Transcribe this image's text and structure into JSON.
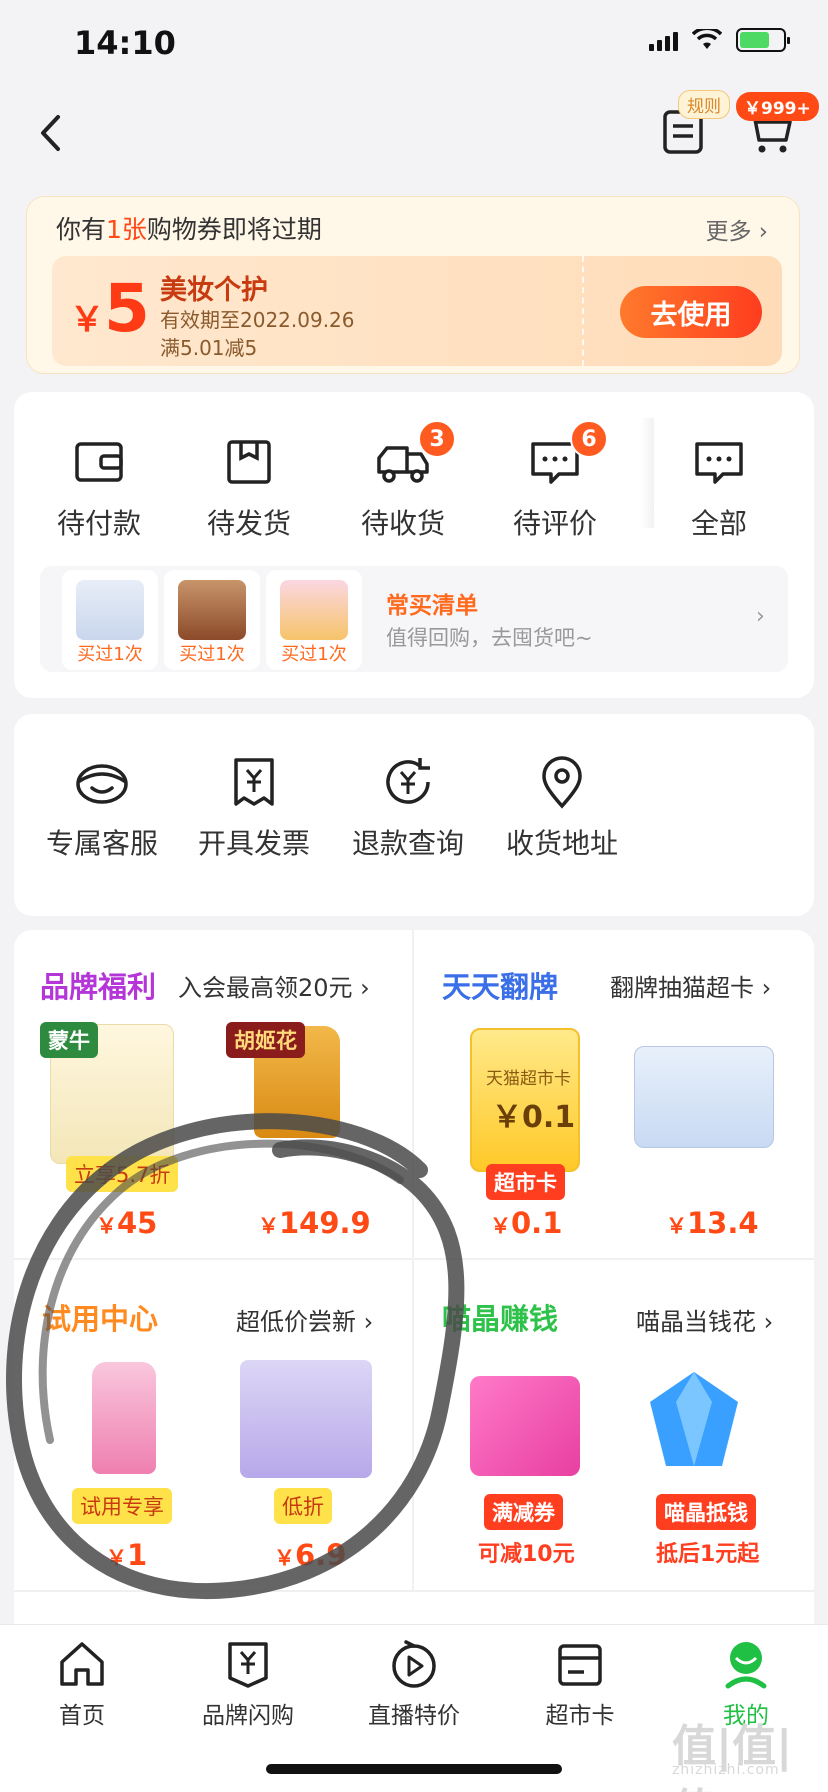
{
  "status_bar": {
    "time": "14:10"
  },
  "header": {
    "rule_badge": "规则",
    "cart_badge": "￥999+"
  },
  "voucher": {
    "head_prefix": "你有",
    "head_count": "1张",
    "head_suffix": "购物券即将过期",
    "more": "更多 ›",
    "coupon": {
      "currency": "￥",
      "amount": "5",
      "title": "美妆个护",
      "valid": "有效期至2022.09.26",
      "rule": "满5.01减5",
      "button": "去使用"
    }
  },
  "orders": {
    "items": [
      {
        "label": "待付款",
        "icon": "wallet-icon"
      },
      {
        "label": "待发货",
        "icon": "package-icon"
      },
      {
        "label": "待收货",
        "icon": "truck-icon",
        "badge": "3"
      },
      {
        "label": "待评价",
        "icon": "comment-icon",
        "badge": "6"
      },
      {
        "label": "全部",
        "icon": "all-orders-icon"
      }
    ],
    "frequent": {
      "thumb_tags": [
        "买过1次",
        "买过1次",
        "买过1次"
      ],
      "title": "常买清单",
      "subtitle": "值得回购，去囤货吧~",
      "chevron": "›"
    }
  },
  "services": {
    "items": [
      {
        "label": "专属客服",
        "icon": "customer-service-icon"
      },
      {
        "label": "开具发票",
        "icon": "invoice-icon"
      },
      {
        "label": "退款查询",
        "icon": "refund-icon"
      },
      {
        "label": "收货地址",
        "icon": "location-icon"
      }
    ]
  },
  "promos": {
    "brand": {
      "title": "品牌福利",
      "subtitle": "入会最高领20元 ›",
      "brand_logo_1": "蒙牛",
      "brand_logo_2": "胡姬花",
      "product_tag": "立享5.7折",
      "prices": [
        "45",
        "149.9"
      ],
      "currency": "￥"
    },
    "flip": {
      "title": "天天翻牌",
      "subtitle": "翻牌抽猫超卡 ›",
      "card_text": "天猫超市卡",
      "card_value": "￥0.1",
      "card_tag": "超市卡",
      "prices": [
        "0.1",
        "13.4"
      ],
      "currency": "￥"
    },
    "trial": {
      "title": "试用中心",
      "subtitle": "超低价尝新 ›",
      "tags": [
        "试用专享",
        "低折"
      ],
      "prices": [
        "1",
        "6.9"
      ],
      "currency": "￥"
    },
    "crystal": {
      "title": "喵晶赚钱",
      "subtitle": "喵晶当钱花 ›",
      "tags": [
        "满减券",
        "喵晶抵钱"
      ],
      "captions": [
        "可减10元",
        "抵后1元起"
      ]
    }
  },
  "tabbar": {
    "items": [
      {
        "label": "首页",
        "icon": "home-icon"
      },
      {
        "label": "品牌闪购",
        "icon": "brand-flash-icon"
      },
      {
        "label": "直播特价",
        "icon": "live-icon"
      },
      {
        "label": "超市卡",
        "icon": "card-icon"
      },
      {
        "label": "我的",
        "icon": "profile-icon",
        "active": true
      }
    ]
  },
  "watermark": {
    "main": "值|值|值",
    "sub": "zhizhizhi.com"
  },
  "colors": {
    "accent": "#ff4a16",
    "orange": "#ff6a1f",
    "purple": "#b536d8",
    "blue": "#3b6fe8",
    "green": "#2fc24a",
    "active_tab": "#20c045"
  }
}
